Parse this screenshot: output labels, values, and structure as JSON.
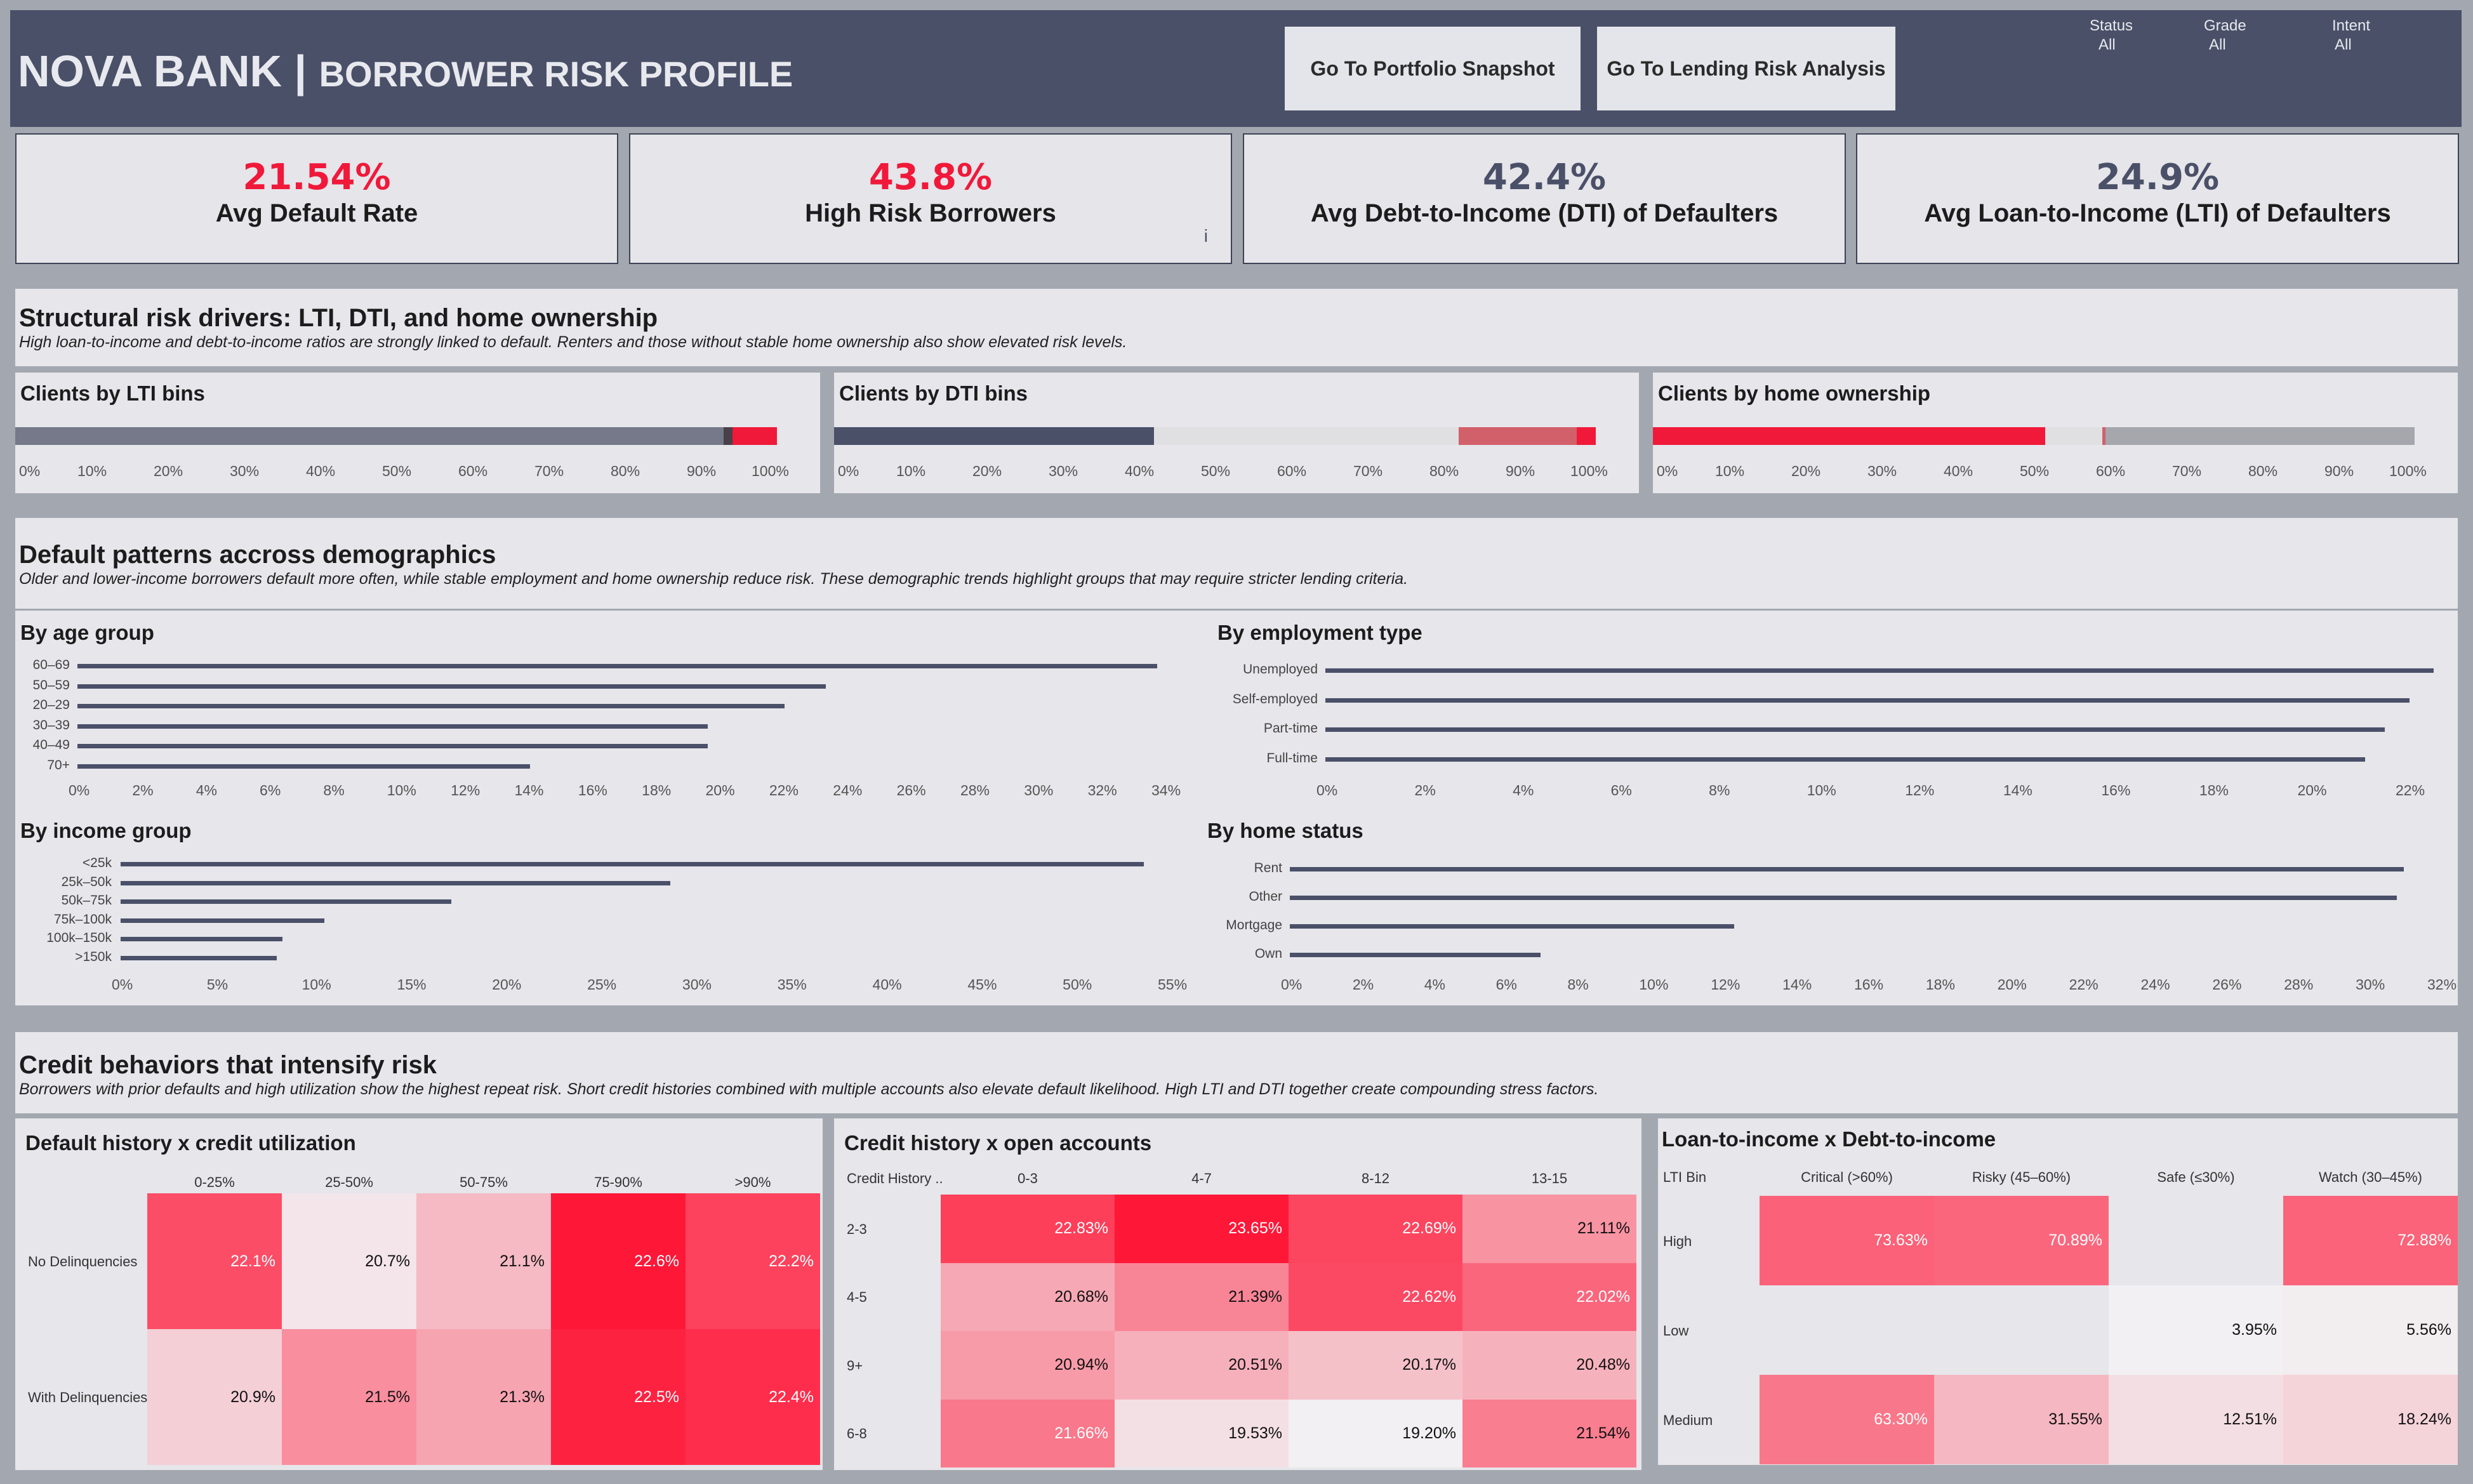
{
  "header": {
    "brand": "NOVA BANK",
    "separator": " | ",
    "subtitle": "BORROWER RISK PROFILE",
    "nav_buttons": [
      "Go To Portfolio Snapshot",
      "Go To Lending Risk Analysis"
    ],
    "filters": [
      {
        "label": "Status",
        "value": "All"
      },
      {
        "label": "Grade",
        "value": "All"
      },
      {
        "label": "Intent",
        "value": "All"
      }
    ]
  },
  "kpis": [
    {
      "value": "21.54%",
      "label": "Avg Default Rate",
      "color": "#f0193a"
    },
    {
      "value": "43.8%",
      "label": "High Risk Borrowers",
      "color": "#f0193a",
      "info": "i"
    },
    {
      "value": "42.4%",
      "label": "Avg Debt-to-Income (DTI) of Defaulters",
      "color": "#4a5068"
    },
    {
      "value": "24.9%",
      "label": "Avg Loan-to-Income (LTI) of Defaulters",
      "color": "#4a5068"
    }
  ],
  "structural": {
    "title": "Structural risk drivers: LTI, DTI, and home ownership",
    "subtitle": "High loan-to-income and debt-to-income ratios are strongly linked to default. Renters and those without stable home ownership also show elevated risk levels.",
    "ticks": [
      "0%",
      "10%",
      "20%",
      "30%",
      "40%",
      "50%",
      "60%",
      "70%",
      "80%",
      "90%",
      "100%"
    ],
    "charts": [
      {
        "title": "Clients by LTI bins",
        "segments": [
          {
            "share": 93.0,
            "color": "#757989"
          },
          {
            "share": 1.2,
            "color": "#4a4048"
          },
          {
            "share": 7.0,
            "color": "#f0193a"
          }
        ]
      },
      {
        "title": "Clients by DTI bins",
        "segments": [
          {
            "share": 42.0,
            "color": "#4a5068"
          },
          {
            "share": 40.0,
            "color": "#e0e0e2"
          },
          {
            "share": 15.5,
            "color": "#d2606a"
          },
          {
            "share": 4.0,
            "color": "#f0193a"
          }
        ]
      },
      {
        "title": "Clients by home ownership",
        "segments": [
          {
            "share": 51.5,
            "color": "#f0193a"
          },
          {
            "share": 7.5,
            "color": "#e0e0e2"
          },
          {
            "share": 0.4,
            "color": "#d2606a"
          },
          {
            "share": 42.0,
            "color": "#a5a7ac"
          }
        ]
      }
    ]
  },
  "demographics": {
    "title": "Default patterns accross demographics",
    "subtitle": "Older and lower-income borrowers default more often, while stable employment and home ownership reduce risk. These demographic trends highlight groups that may require stricter lending criteria.",
    "charts": [
      {
        "title": "By age group",
        "categories": [
          "60–69",
          "50–59",
          "20–29",
          "30–39",
          "40–49",
          "70+"
        ],
        "values": [
          33.9,
          23.5,
          22.2,
          19.8,
          19.8,
          14.2
        ],
        "ticks": [
          "0%",
          "2%",
          "4%",
          "6%",
          "8%",
          "10%",
          "12%",
          "14%",
          "16%",
          "18%",
          "20%",
          "22%",
          "24%",
          "26%",
          "28%",
          "30%",
          "32%",
          "34%"
        ],
        "max": 34
      },
      {
        "title": "By employment type",
        "categories": [
          "Unemployed",
          "Self-employed",
          "Part-time",
          "Full-time"
        ],
        "values": [
          22.6,
          22.1,
          21.6,
          21.2
        ],
        "ticks": [
          "0%",
          "2%",
          "4%",
          "6%",
          "8%",
          "10%",
          "12%",
          "14%",
          "16%",
          "18%",
          "20%",
          "22%"
        ],
        "max": 22
      },
      {
        "title": "By income group",
        "categories": [
          "<25k",
          "25k–50k",
          "50k–75k",
          "75k–100k",
          "100k–150k",
          ">150k"
        ],
        "values": [
          53.8,
          28.9,
          17.4,
          10.7,
          8.5,
          8.2
        ],
        "ticks": [
          "0%",
          "5%",
          "10%",
          "15%",
          "20%",
          "25%",
          "30%",
          "35%",
          "40%",
          "45%",
          "50%",
          "55%"
        ],
        "max": 55
      },
      {
        "title": "By home status",
        "categories": [
          "Rent",
          "Other",
          "Mortgage",
          "Own"
        ],
        "values": [
          31.1,
          30.9,
          12.4,
          7.0
        ],
        "ticks": [
          "0%",
          "2%",
          "4%",
          "6%",
          "8%",
          "10%",
          "12%",
          "14%",
          "16%",
          "18%",
          "20%",
          "22%",
          "24%",
          "26%",
          "28%",
          "30%",
          "32%"
        ],
        "max": 32
      }
    ]
  },
  "credit": {
    "title": "Credit behaviors that intensify risk",
    "subtitle": "Borrowers with prior defaults and high utilization show the highest repeat risk. Short credit histories combined with multiple accounts also elevate default likelihood. High LTI and DTI together create compounding stress factors.",
    "heatmaps": [
      {
        "title": "Default history x credit utilization",
        "corner": "",
        "columns": [
          "0-25%",
          "25-50%",
          "50-75%",
          "75-90%",
          ">90%"
        ],
        "rows": [
          {
            "label": "No Delinquencies",
            "cells": [
              "22.1%",
              "20.7%",
              "21.1%",
              "22.6%",
              "22.2%"
            ],
            "values": [
              22.1,
              20.7,
              21.1,
              22.6,
              22.2
            ]
          },
          {
            "label": "With Delinquencies",
            "cells": [
              "20.9%",
              "21.5%",
              "21.3%",
              "22.5%",
              "22.4%"
            ],
            "values": [
              20.9,
              21.5,
              21.3,
              22.5,
              22.4
            ]
          }
        ]
      },
      {
        "title": "Credit history x open accounts",
        "corner": "Credit History ..",
        "columns": [
          "0-3",
          "4-7",
          "8-12",
          "13-15"
        ],
        "rows": [
          {
            "label": "2-3",
            "cells": [
              "22.83%",
              "23.65%",
              "22.69%",
              "21.11%"
            ],
            "values": [
              22.83,
              23.65,
              22.69,
              21.11
            ]
          },
          {
            "label": "4-5",
            "cells": [
              "20.68%",
              "21.39%",
              "22.62%",
              "22.02%"
            ],
            "values": [
              20.68,
              21.39,
              22.62,
              22.02
            ]
          },
          {
            "label": "9+",
            "cells": [
              "20.94%",
              "20.51%",
              "20.17%",
              "20.48%"
            ],
            "values": [
              20.94,
              20.51,
              20.17,
              20.48
            ]
          },
          {
            "label": "6-8",
            "cells": [
              "21.66%",
              "19.53%",
              "19.20%",
              "21.54%"
            ],
            "values": [
              21.66,
              19.53,
              19.2,
              21.54
            ]
          }
        ]
      },
      {
        "title": "Loan-to-income x Debt-to-income",
        "corner": "LTI Bin",
        "columns": [
          "Critical (>60%)",
          "Risky (45–60%)",
          "Safe (≤30%)",
          "Watch (30–45%)"
        ],
        "rows": [
          {
            "label": "High",
            "cells": [
              "73.63%",
              "70.89%",
              "",
              "72.88%"
            ],
            "values": [
              73.63,
              70.89,
              null,
              72.88
            ]
          },
          {
            "label": "Low",
            "cells": [
              "",
              "",
              "3.95%",
              "5.56%"
            ],
            "values": [
              null,
              null,
              3.95,
              5.56
            ]
          },
          {
            "label": "Medium",
            "cells": [
              "63.30%",
              "31.55%",
              "12.51%",
              "18.24%"
            ],
            "values": [
              63.3,
              31.55,
              12.51,
              18.24
            ]
          }
        ]
      }
    ]
  }
}
